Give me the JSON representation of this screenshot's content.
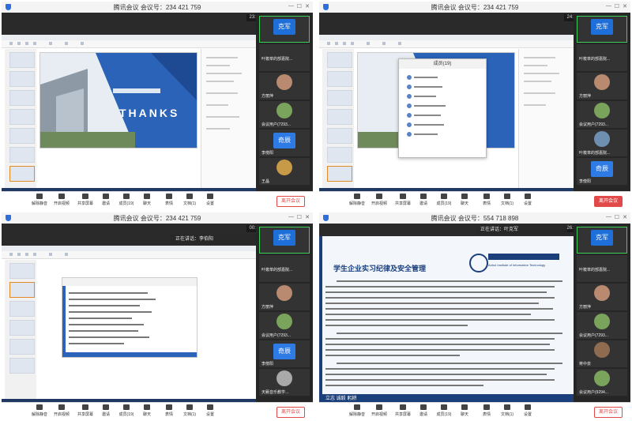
{
  "panels": [
    {
      "title": "腾讯会议 会议号：234 421 759",
      "time": "23:31",
      "slide_heading": "THANKS",
      "participants": [
        {
          "name": "",
          "badge": "克军"
        },
        {
          "name": "叶筱萃的部嘉院..."
        },
        {
          "name": "方丽萍"
        },
        {
          "name": "会议用户(7293..."
        },
        {
          "name": "李傍阳",
          "badge": "奇辰"
        },
        {
          "name": "王晶"
        }
      ]
    },
    {
      "title": "腾讯会议 会议号：234 421 759",
      "time": "24:21",
      "dialog_title": "成员(19)",
      "participants": [
        {
          "name": "",
          "badge": "克军"
        },
        {
          "name": "叶筱萃的部嘉院..."
        },
        {
          "name": "方丽萍"
        },
        {
          "name": "会议用户(7293..."
        },
        {
          "name": "叶筱萃的部嘉院..."
        },
        {
          "name": "李傍阳",
          "badge": "奇辰"
        }
      ]
    },
    {
      "title": "腾讯会议 会议号：234 421 759",
      "time": "00:19",
      "speaking": "正在讲话：李伯阳",
      "participants": [
        {
          "name": "",
          "badge": "克军"
        },
        {
          "name": "叶筱萃的部嘉院..."
        },
        {
          "name": "方丽萍"
        },
        {
          "name": "会议用户(7293..."
        },
        {
          "name": "李傍阳",
          "badge": "奇辰"
        },
        {
          "name": "天籁音乐教学..."
        }
      ]
    },
    {
      "title": "腾讯会议 会议号：554 718 898",
      "time": "26:09",
      "speaking": "正在讲话：叶克军",
      "doc_heading": "学生企业实习纪律及安全管理",
      "school_en": "Anhui Institute of Information Technology",
      "footer_caption": "立志  诚毅  躬耕",
      "participants": [
        {
          "name": "",
          "badge": "克军"
        },
        {
          "name": "叶筱萃的部嘉院..."
        },
        {
          "name": "方丽萍"
        },
        {
          "name": "会议用户(7293..."
        },
        {
          "name": "蒋中泉"
        },
        {
          "name": "会议用户(9294..."
        }
      ]
    }
  ],
  "controls": [
    {
      "label": "解除静音",
      "icon": "mic-muted-icon"
    },
    {
      "label": "开启视频",
      "icon": "camera-off-icon"
    },
    {
      "label": "共享屏幕",
      "icon": "screen-share-icon"
    },
    {
      "label": "邀请",
      "icon": "invite-icon"
    },
    {
      "label": "成员(19)",
      "icon": "members-icon"
    },
    {
      "label": "聊天",
      "icon": "chat-icon"
    },
    {
      "label": "表情",
      "icon": "emoji-icon"
    },
    {
      "label": "文档(1)",
      "icon": "document-icon"
    },
    {
      "label": "设置",
      "icon": "settings-icon"
    }
  ],
  "leave_label": "离开会议",
  "colors": {
    "accent": "#1e6fd9",
    "leave": "#e24a4a",
    "slide_blue": "#2b63b8"
  }
}
